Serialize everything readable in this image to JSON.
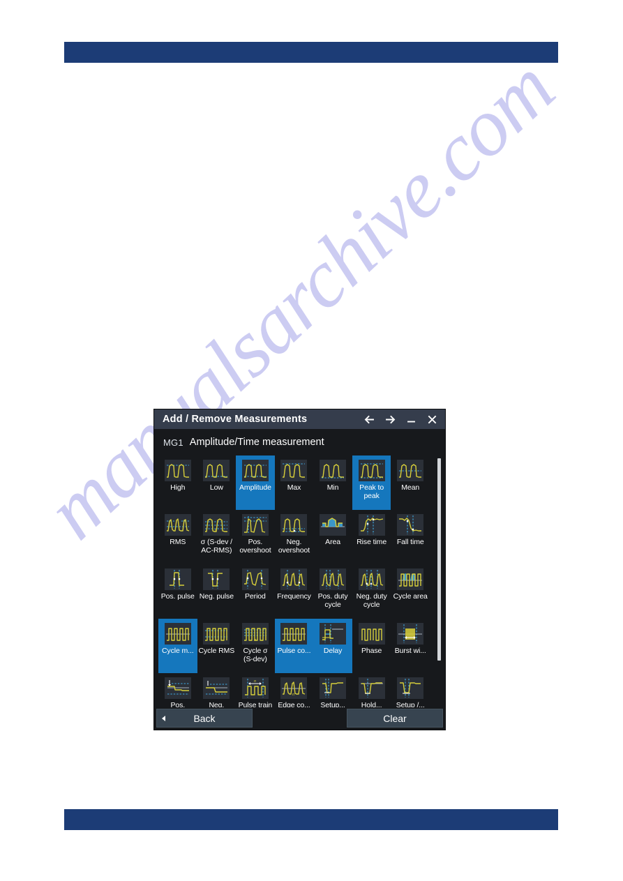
{
  "page": {
    "watermark_text": "manualsarchive.com",
    "header_bar_color": "#1c3c76",
    "footer_bar_color": "#1c3c76"
  },
  "dialog": {
    "title": "Add / Remove Measurements",
    "titlebar_icons": [
      {
        "name": "back-arrow-icon",
        "label": "Back"
      },
      {
        "name": "forward-arrow-icon",
        "label": "Forward"
      },
      {
        "name": "minimize-icon",
        "label": "Minimize"
      },
      {
        "name": "close-icon",
        "label": "Close"
      }
    ],
    "subheader": {
      "group": "MG1",
      "title": "Amplitude/Time measurement"
    },
    "selection_color": "#1577bd",
    "tiles": [
      {
        "label": "High",
        "icon": "high-waveform-icon",
        "selected": false
      },
      {
        "label": "Low",
        "icon": "low-waveform-icon",
        "selected": false
      },
      {
        "label": "Amplitude",
        "icon": "amplitude-waveform-icon",
        "selected": true
      },
      {
        "label": "Max",
        "icon": "max-waveform-icon",
        "selected": false
      },
      {
        "label": "Min",
        "icon": "min-waveform-icon",
        "selected": false
      },
      {
        "label": "Peak to\npeak",
        "icon": "peak-to-peak-waveform-icon",
        "selected": true
      },
      {
        "label": "Mean",
        "icon": "mean-waveform-icon",
        "selected": false
      },
      {
        "label": "RMS",
        "icon": "rms-waveform-icon",
        "selected": false
      },
      {
        "label": "σ (S-dev /\nAC-RMS)",
        "icon": "sigma-sdev-waveform-icon",
        "selected": false
      },
      {
        "label": "Pos.\novershoot",
        "icon": "pos-overshoot-waveform-icon",
        "selected": false
      },
      {
        "label": "Neg.\novershoot",
        "icon": "neg-overshoot-waveform-icon",
        "selected": false
      },
      {
        "label": "Area",
        "icon": "area-waveform-icon",
        "selected": false
      },
      {
        "label": "Rise time",
        "icon": "rise-time-waveform-icon",
        "selected": false
      },
      {
        "label": "Fall time",
        "icon": "fall-time-waveform-icon",
        "selected": false
      },
      {
        "label": "Pos. pulse",
        "icon": "pos-pulse-waveform-icon",
        "selected": false
      },
      {
        "label": "Neg. pulse",
        "icon": "neg-pulse-waveform-icon",
        "selected": false
      },
      {
        "label": "Period",
        "icon": "period-waveform-icon",
        "selected": false
      },
      {
        "label": "Frequency",
        "icon": "frequency-waveform-icon",
        "selected": false
      },
      {
        "label": "Pos. duty\ncycle",
        "icon": "pos-duty-cycle-waveform-icon",
        "selected": false
      },
      {
        "label": "Neg. duty\ncycle",
        "icon": "neg-duty-cycle-waveform-icon",
        "selected": false
      },
      {
        "label": "Cycle area",
        "icon": "cycle-area-waveform-icon",
        "selected": false
      },
      {
        "label": "Cycle m...",
        "icon": "cycle-mean-waveform-icon",
        "selected": true
      },
      {
        "label": "Cycle RMS",
        "icon": "cycle-rms-waveform-icon",
        "selected": false
      },
      {
        "label": "Cycle σ\n(S-dev)",
        "icon": "cycle-sigma-waveform-icon",
        "selected": false
      },
      {
        "label": "Pulse co...",
        "icon": "pulse-count-waveform-icon",
        "selected": true
      },
      {
        "label": "Delay",
        "icon": "delay-waveform-icon",
        "selected": true
      },
      {
        "label": "Phase",
        "icon": "phase-waveform-icon",
        "selected": false
      },
      {
        "label": "Burst wi...",
        "icon": "burst-width-waveform-icon",
        "selected": false
      },
      {
        "label": "Pos.",
        "icon": "pos-settling-waveform-icon",
        "selected": false
      },
      {
        "label": "Neg.",
        "icon": "neg-settling-waveform-icon",
        "selected": false
      },
      {
        "label": "Pulse train",
        "icon": "pulse-train-waveform-icon",
        "selected": false
      },
      {
        "label": "Edge co...",
        "icon": "edge-count-waveform-icon",
        "selected": false
      },
      {
        "label": "Setup...",
        "icon": "setup-time-waveform-icon",
        "selected": false
      },
      {
        "label": "Hold...",
        "icon": "hold-time-waveform-icon",
        "selected": false
      },
      {
        "label": "Setup /...",
        "icon": "setup-hold-waveform-icon",
        "selected": false
      }
    ],
    "buttons": {
      "back": "Back",
      "clear": "Clear"
    }
  }
}
